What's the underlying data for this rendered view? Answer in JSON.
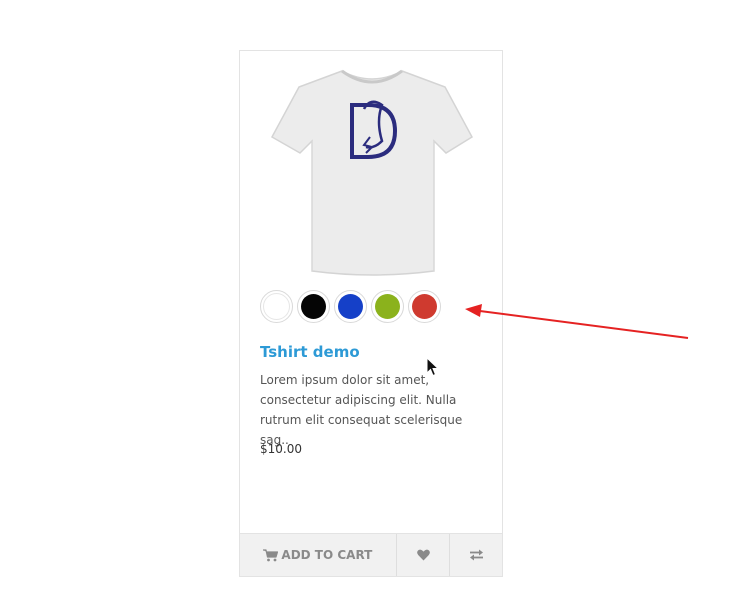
{
  "product": {
    "name": "Tshirt demo",
    "description": "Lorem ipsum dolor sit amet, consectetur adipiscing elit. Nulla rutrum elit consequat scelerisque sag..",
    "price": "$10.00",
    "image_icon": "tshirt-image",
    "swatches": [
      {
        "name": "white",
        "color": "#ffffff"
      },
      {
        "name": "black",
        "color": "#050505"
      },
      {
        "name": "blue",
        "color": "#1540c8"
      },
      {
        "name": "green",
        "color": "#8bb21c"
      },
      {
        "name": "red",
        "color": "#cf3a2f"
      }
    ]
  },
  "actions": {
    "add_to_cart_label": "ADD TO CART",
    "cart_icon": "cart-icon",
    "wishlist_icon": "heart-icon",
    "compare_icon": "compare-arrows-icon"
  },
  "annotation": {
    "arrow_color": "#e52222"
  },
  "colors": {
    "title": "#2d9ad6",
    "button_bg": "#f1f1f1",
    "button_text": "#8a8a8a"
  }
}
